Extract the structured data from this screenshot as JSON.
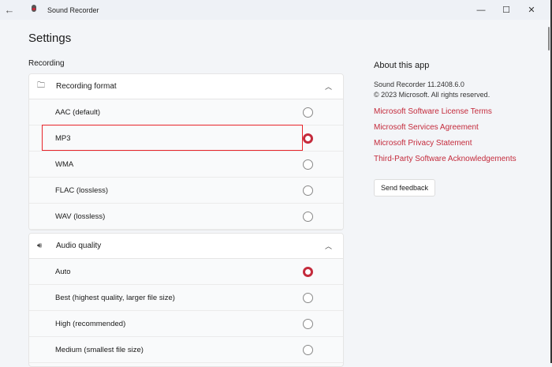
{
  "titlebar": {
    "title": "Sound Recorder"
  },
  "page": {
    "title": "Settings",
    "section": "Recording"
  },
  "recording_format": {
    "label": "Recording format",
    "options": [
      {
        "label": "AAC (default)",
        "selected": false
      },
      {
        "label": "MP3",
        "selected": true
      },
      {
        "label": "WMA",
        "selected": false
      },
      {
        "label": "FLAC (lossless)",
        "selected": false
      },
      {
        "label": "WAV (lossless)",
        "selected": false
      }
    ]
  },
  "audio_quality": {
    "label": "Audio quality",
    "options": [
      {
        "label": "Auto",
        "selected": true
      },
      {
        "label": "Best (highest quality, larger file size)",
        "selected": false
      },
      {
        "label": "High (recommended)",
        "selected": false
      },
      {
        "label": "Medium (smallest file size)",
        "selected": false
      }
    ]
  },
  "about": {
    "title": "About this app",
    "version": "Sound Recorder 11.2408.6.0",
    "copyright": "© 2023 Microsoft. All rights reserved.",
    "links": [
      "Microsoft Software License Terms",
      "Microsoft Services Agreement",
      "Microsoft Privacy Statement",
      "Third-Party Software Acknowledgements"
    ],
    "feedback": "Send feedback"
  },
  "colors": {
    "accent": "#c42b3c",
    "annotation": "#e8242a"
  }
}
